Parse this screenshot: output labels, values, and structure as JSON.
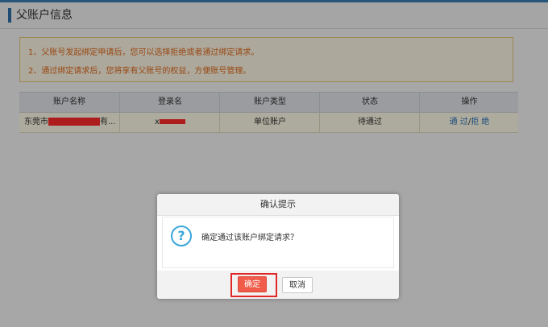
{
  "header": {
    "title": "父账户信息"
  },
  "notice": {
    "line1": "1、父账号发起绑定申请后，您可以选择拒绝或者通过绑定请求。",
    "line2": "2、通过绑定请求后，您将享有父账号的权益，方便账号管理。"
  },
  "table": {
    "headers": [
      "账户名称",
      "登录名",
      "账户类型",
      "状态",
      "操作"
    ],
    "rows": [
      {
        "name_prefix": "东莞市",
        "name_suffix": "有...",
        "login_prefix": "x",
        "type": "单位账户",
        "status": "待通过",
        "action_approve": "通 过",
        "action_sep": "/",
        "action_reject": "拒 绝"
      }
    ]
  },
  "dialog": {
    "title": "确认提示",
    "message": "确定通过该账户绑定请求？",
    "icon": "question-icon",
    "icon_glyph": "?",
    "ok_label": "确定",
    "cancel_label": "取消"
  },
  "colors": {
    "accent": "#2f6fa8",
    "notice_text": "#e06a1b",
    "link": "#2f72bd",
    "ok_button": "#f05b4a",
    "highlight_border": "#e02828",
    "redaction": "#ff2b2b"
  }
}
